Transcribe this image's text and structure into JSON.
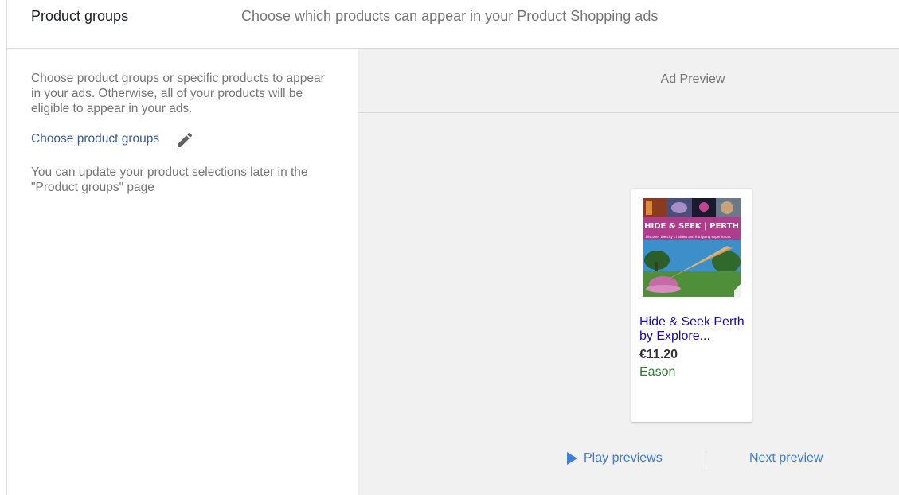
{
  "header": {
    "title": "Product groups",
    "description": "Choose which products can appear in your Product Shopping ads"
  },
  "left_panel": {
    "intro": "Choose product groups or specific products to appear in your ads. Otherwise, all of your products will be eligible to appear in your ads.",
    "choose_link": "Choose product groups",
    "edit_icon": "pencil-icon",
    "later_note": "You can update your product selections later in the \"Product groups\" page"
  },
  "preview": {
    "title": "Ad Preview",
    "card": {
      "image_banner_text": "HIDE & SEEK | PERTH",
      "image_subtitle": "Discover the city's hidden and intriguing experiences",
      "title_line1": "Hide & Seek Perth",
      "title_line2": "by Explore...",
      "price": "€11.20",
      "store": "Eason"
    },
    "play_label": "Play previews",
    "play_icon": "play-icon",
    "next_label": "Next preview"
  },
  "colors": {
    "link": "#3c5a9a",
    "accent": "#3f7de0",
    "ad_title": "#1a0dab",
    "store": "#2e7d32",
    "preview_bg": "#f1f1f1"
  }
}
